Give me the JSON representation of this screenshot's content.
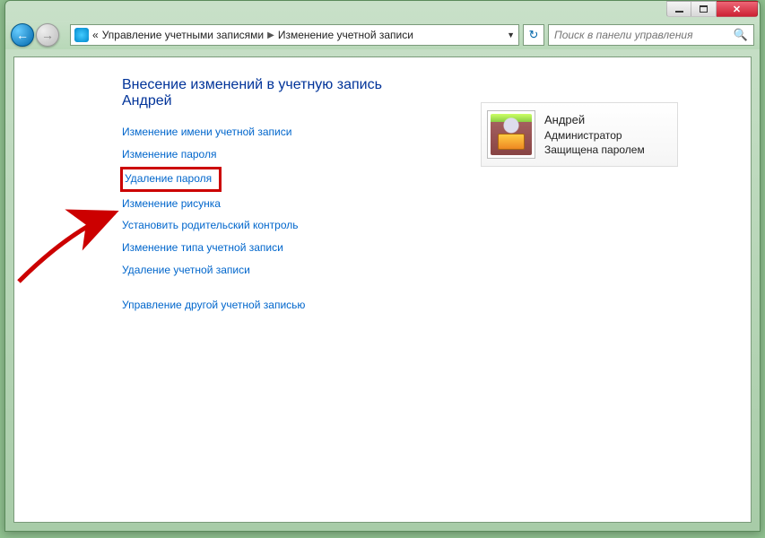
{
  "breadcrumb": {
    "prefix": "«",
    "item1": "Управление учетными записями",
    "item2": "Изменение учетной записи"
  },
  "search": {
    "placeholder": "Поиск в панели управления"
  },
  "heading": "Внесение изменений в учетную запись Андрей",
  "links": {
    "change_name": "Изменение имени учетной записи",
    "change_password": "Изменение пароля",
    "delete_password": "Удаление пароля",
    "change_picture": "Изменение рисунка",
    "parental_controls": "Установить родительский контроль",
    "change_type": "Изменение типа учетной записи",
    "delete_account": "Удаление учетной записи",
    "manage_other": "Управление другой учетной записью"
  },
  "user": {
    "name": "Андрей",
    "role": "Администратор",
    "status": "Защищена паролем"
  }
}
